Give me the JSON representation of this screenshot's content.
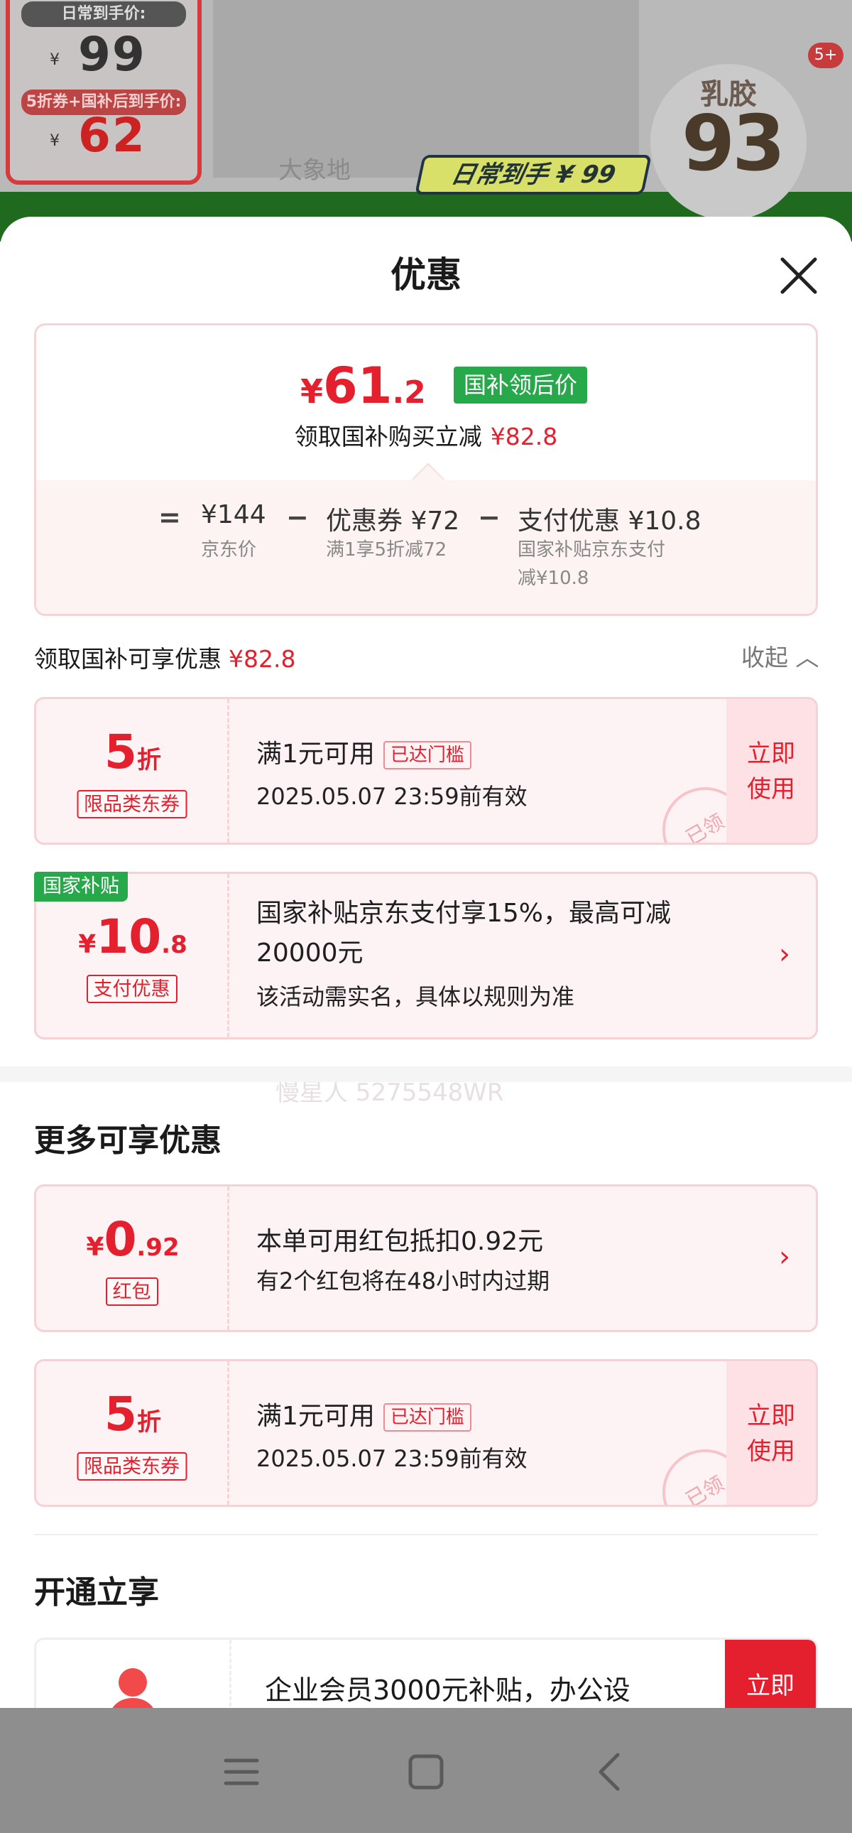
{
  "background": {
    "daily_price_label": "日常到手价:",
    "daily_price": "99",
    "coupon_price_label": "5折券+国补后到手价:",
    "coupon_price": "62",
    "currency": "¥",
    "badge_label": "乳胶",
    "badge_percent": "93",
    "notif_badge": "5+",
    "dim_text": "大象地",
    "daily_tag": "日常到手 ¥ 99"
  },
  "sheet": {
    "title": "优惠",
    "summary": {
      "price_currency": "¥",
      "price_int": "61",
      "price_dec": ".2",
      "price_tag": "国补领后价",
      "subtitle": "领取国补购买立减",
      "subtitle_amount": "¥82.8",
      "equals": "=",
      "minus": "−",
      "items": [
        {
          "value": "¥144",
          "label": "京东价"
        },
        {
          "value": "优惠券 ¥72",
          "label": "满1享5折减72"
        },
        {
          "value": "支付优惠 ¥10.8",
          "label": "国家补贴京东支付",
          "label2": "减¥10.8"
        }
      ]
    },
    "claim_label": "领取国补可享优惠",
    "claim_amount": "¥82.8",
    "collapse_label": "收起 ︿",
    "coupons": [
      {
        "big": "5",
        "unit": "折",
        "pill": "限品类东券",
        "title": "满1元可用",
        "threshold": "已达门槛",
        "sub": "2025.05.07 23:59前有效",
        "action_1": "立即",
        "action_2": "使用",
        "stamp": "已领"
      },
      {
        "tag": "国家补贴",
        "currency": "¥",
        "big": "10",
        "dec": ".8",
        "pill": "支付优惠",
        "title_1": "国家补贴京东支付享15%，最高可减",
        "title_2": "20000元",
        "sub": "该活动需实名，具体以规则为准",
        "chevron": "›"
      }
    ],
    "watermark": "慢星人 5275548WR",
    "more_title": "更多可享优惠",
    "more": [
      {
        "currency": "¥",
        "big": "0",
        "dec": ".92",
        "pill": "红包",
        "title": "本单可用红包抵扣0.92元",
        "sub": "有2个红包将在48小时内过期",
        "chevron": "›"
      },
      {
        "big": "5",
        "unit": "折",
        "pill": "限品类东券",
        "title": "满1元可用",
        "threshold": "已达门槛",
        "sub": "2025.05.07 23:59前有效",
        "action_1": "立即",
        "action_2": "使用",
        "stamp": "已领"
      }
    ],
    "join_title": "开通立享",
    "join_card": {
      "text": "企业会员3000元补贴，办公设",
      "action": "立即"
    }
  },
  "colors": {
    "accent": "#e5202e",
    "green": "#27a84a",
    "navbar": "#8e8e8e"
  },
  "navbar": {
    "icons": [
      "menu-icon",
      "home-square-icon",
      "back-icon"
    ]
  }
}
